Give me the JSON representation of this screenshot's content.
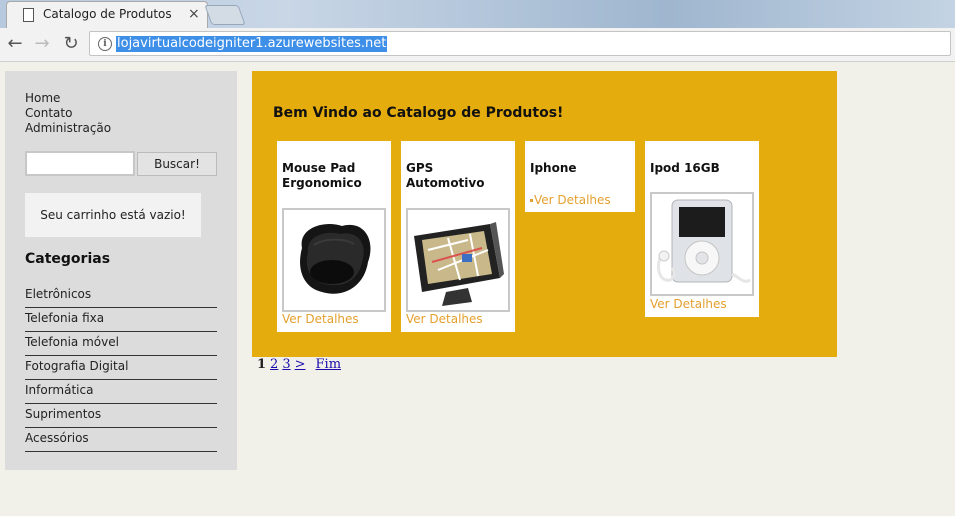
{
  "browser": {
    "tab_title": "Catalogo de Produtos | H",
    "tab_close": "×",
    "url": "lojavirtualcodeigniter1.azurewebsites.net",
    "back": "←",
    "forward": "→",
    "reload": "↻",
    "info": "i"
  },
  "sidebar": {
    "nav": [
      "Home",
      "Contato",
      "Administração"
    ],
    "search_button": "Buscar!",
    "search_value": "",
    "cart_message": "Seu carrinho está vazio!",
    "categories_title": "Categorias",
    "categories": [
      "Eletrônicos",
      "Telefonia fixa",
      "Telefonia móvel",
      "Fotografia Digital",
      "Informática",
      "Suprimentos",
      "Acessórios"
    ]
  },
  "main": {
    "welcome": "Bem Vindo ao Catalogo de Produtos!",
    "products": [
      {
        "name": "Mouse Pad Ergonomico",
        "link": "Ver Detalhes"
      },
      {
        "name": "GPS Automotivo",
        "link": "Ver Detalhes"
      },
      {
        "name": "Iphone",
        "link": "Ver Detalhes"
      },
      {
        "name": "Ipod 16GB",
        "link": "Ver Detalhes"
      }
    ]
  },
  "pagination": {
    "current": "1",
    "pages": [
      "2",
      "3"
    ],
    "next": ">",
    "last": "Fim"
  }
}
